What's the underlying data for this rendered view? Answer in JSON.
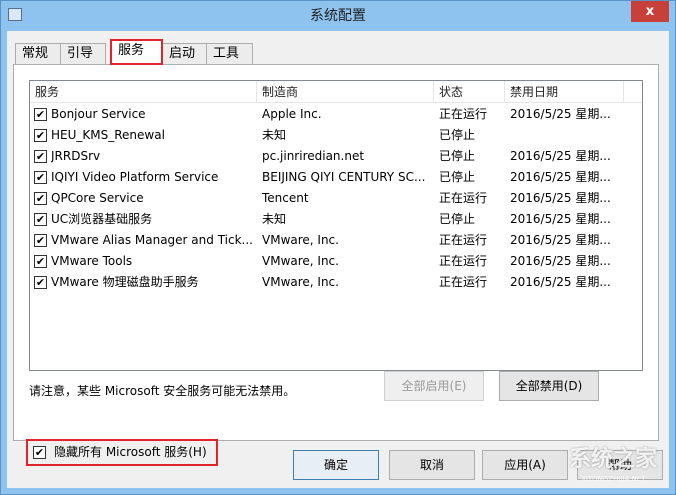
{
  "window": {
    "title": "系统配置",
    "close": "x"
  },
  "tabs": [
    "常规",
    "引导",
    "服务",
    "启动",
    "工具"
  ],
  "columns": [
    "服务",
    "制造商",
    "状态",
    "禁用日期"
  ],
  "rows": [
    {
      "service": "Bonjour Service",
      "maker": "Apple Inc.",
      "status": "正在运行",
      "date": "2016/5/25 星期..."
    },
    {
      "service": "HEU_KMS_Renewal",
      "maker": "未知",
      "status": "已停止",
      "date": ""
    },
    {
      "service": "JRRDSrv",
      "maker": "pc.jinriredian.net",
      "status": "已停止",
      "date": "2016/5/25 星期..."
    },
    {
      "service": "IQIYI Video Platform Service",
      "maker": "BEIJING QIYI CENTURY SC...",
      "status": "已停止",
      "date": "2016/5/25 星期..."
    },
    {
      "service": "QPCore Service",
      "maker": "Tencent",
      "status": "正在运行",
      "date": "2016/5/25 星期..."
    },
    {
      "service": "UC浏览器基础服务",
      "maker": "未知",
      "status": "已停止",
      "date": "2016/5/25 星期..."
    },
    {
      "service": "VMware Alias Manager and Tick...",
      "maker": "VMware, Inc.",
      "status": "正在运行",
      "date": "2016/5/25 星期..."
    },
    {
      "service": "VMware Tools",
      "maker": "VMware, Inc.",
      "status": "正在运行",
      "date": "2016/5/25 星期..."
    },
    {
      "service": "VMware 物理磁盘助手服务",
      "maker": "VMware, Inc.",
      "status": "正在运行",
      "date": "2016/5/25 星期..."
    }
  ],
  "note": "请注意，某些 Microsoft 安全服务可能无法禁用。",
  "enable_all": "全部启用(E)",
  "disable_all": "全部禁用(D)",
  "hide_ms": "隐藏所有 Microsoft 服务(H)",
  "footer": {
    "ok": "确定",
    "cancel": "取消",
    "apply": "应用(A)",
    "help": "帮助"
  },
  "watermark": {
    "text": "系统之家",
    "sub": "XITONGZHIJIA.NET"
  }
}
